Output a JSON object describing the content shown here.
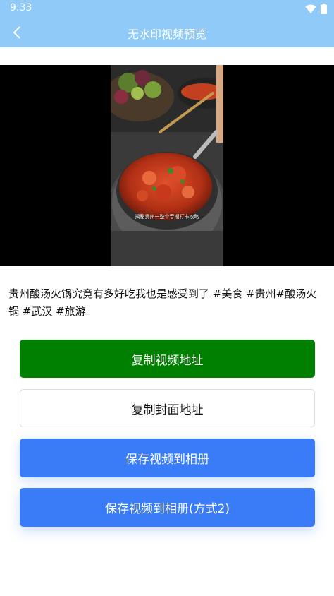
{
  "status_bar": {
    "time": "9:33"
  },
  "app_bar": {
    "title": "无水印视频预览"
  },
  "video": {
    "subtitle_text": "揭秘贵州一整个春期打卡攻略"
  },
  "caption": "贵州酸汤火锅究竟有多好吃我也是感受到了 #美食 #贵州#酸汤火锅 #武汉 #旅游",
  "buttons": {
    "copy_video": "复制视频地址",
    "copy_cover": "复制封面地址",
    "save_video": "保存视频到相册",
    "save_video_alt": "保存视频到相册(方式2)"
  },
  "colors": {
    "app_bar": "#90caf9",
    "copy_video_button": "#008000",
    "save_buttons": "#3a7cf8"
  }
}
